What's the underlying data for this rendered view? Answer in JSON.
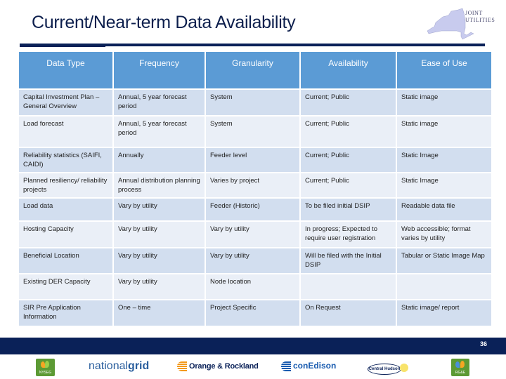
{
  "header": {
    "title": "Current/Near-term Data Availability",
    "logo_text_line1": "JOINT",
    "logo_text_line2": "UTILITIES"
  },
  "table": {
    "columns": [
      "Data Type",
      "Frequency",
      "Granularity",
      "Availability",
      "Ease of Use"
    ],
    "rows": [
      [
        "Capital Investment Plan – General Overview",
        "Annual, 5 year forecast period",
        "System",
        "Current; Public",
        "Static image"
      ],
      [
        "Load forecast",
        "Annual, 5 year forecast period",
        "System",
        "Current; Public",
        "Static image"
      ],
      [
        "Reliability statistics (SAIFI, CAIDI)",
        "Annually",
        "Feeder level",
        "Current; Public",
        "Static Image"
      ],
      [
        "Planned resiliency/ reliability projects",
        "Annual distribution planning process",
        "Varies by project",
        "Current; Public",
        "Static Image"
      ],
      [
        "Load data",
        "Vary by utility",
        "Feeder (Historic)",
        "To be filed initial DSIP",
        "Readable data file"
      ],
      [
        "Hosting Capacity",
        "Vary by utility",
        "Vary by utility",
        "In progress; Expected to require user registration",
        "Web accessible; format varies by utility"
      ],
      [
        "Beneficial Location",
        "Vary by utility",
        "Vary by utility",
        "Will be filed with the Initial DSIP",
        "Tabular or Static Image Map"
      ],
      [
        "Existing DER Capacity",
        "Vary by utility",
        "Node location",
        "",
        ""
      ],
      [
        "SIR Pre Application Information",
        "One – time",
        "Project Specific",
        "On Request",
        "Static image/ report"
      ]
    ]
  },
  "footer": {
    "page_number": "36",
    "logos": {
      "nyseg": "NYSEG",
      "national_grid_prefix": "national",
      "national_grid_suffix": "grid",
      "orange_rockland": "Orange & Rockland",
      "con_edison": "conEdison",
      "central_hudson": "Central Hudson",
      "rge": "RG&E"
    }
  },
  "colors": {
    "title": "#0d1f4d",
    "navy_bar": "#0a2158",
    "header_fill": "#5b9bd5",
    "row_dark": "#d2deef",
    "row_light": "#eaeff7"
  }
}
